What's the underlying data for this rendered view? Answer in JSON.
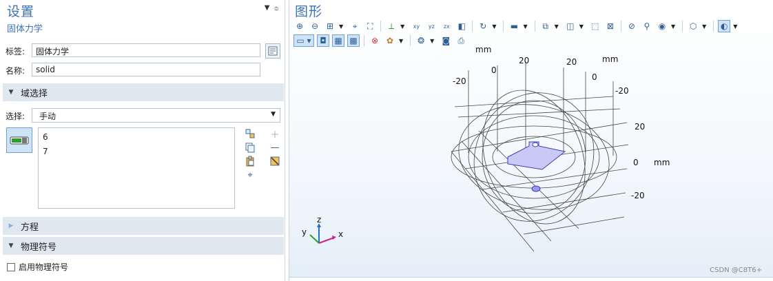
{
  "settings": {
    "title": "设置",
    "subtitle": "固体力学",
    "label_caption": "标签:",
    "label_value": "固体力学",
    "name_caption": "名称:",
    "name_value": "solid"
  },
  "domain_selection": {
    "section_title": "域选择",
    "select_caption": "选择:",
    "select_value": "手动",
    "items": [
      "6",
      "7"
    ]
  },
  "equation": {
    "section_title": "方程"
  },
  "physics_symbols": {
    "section_title": "物理符号",
    "checkbox_label": "启用物理符号",
    "checkbox_checked": false
  },
  "graphics": {
    "title": "图形",
    "axis_unit": "mm",
    "ticks_back_left": [
      "-20",
      "0",
      "20"
    ],
    "ticks_back_right": [
      "20",
      "0",
      "-20"
    ],
    "ticks_right_vertical": [
      "20",
      "0",
      "-20"
    ],
    "triad": {
      "x": "x",
      "y": "y",
      "z": "z"
    },
    "watermark": "CSDN @C8T6+"
  },
  "colors": {
    "accent": "#3a72b8",
    "section_bg": "#dfe8f1",
    "selection_fill": "#c9c9f5",
    "selection_stroke": "#3b3bb8"
  }
}
